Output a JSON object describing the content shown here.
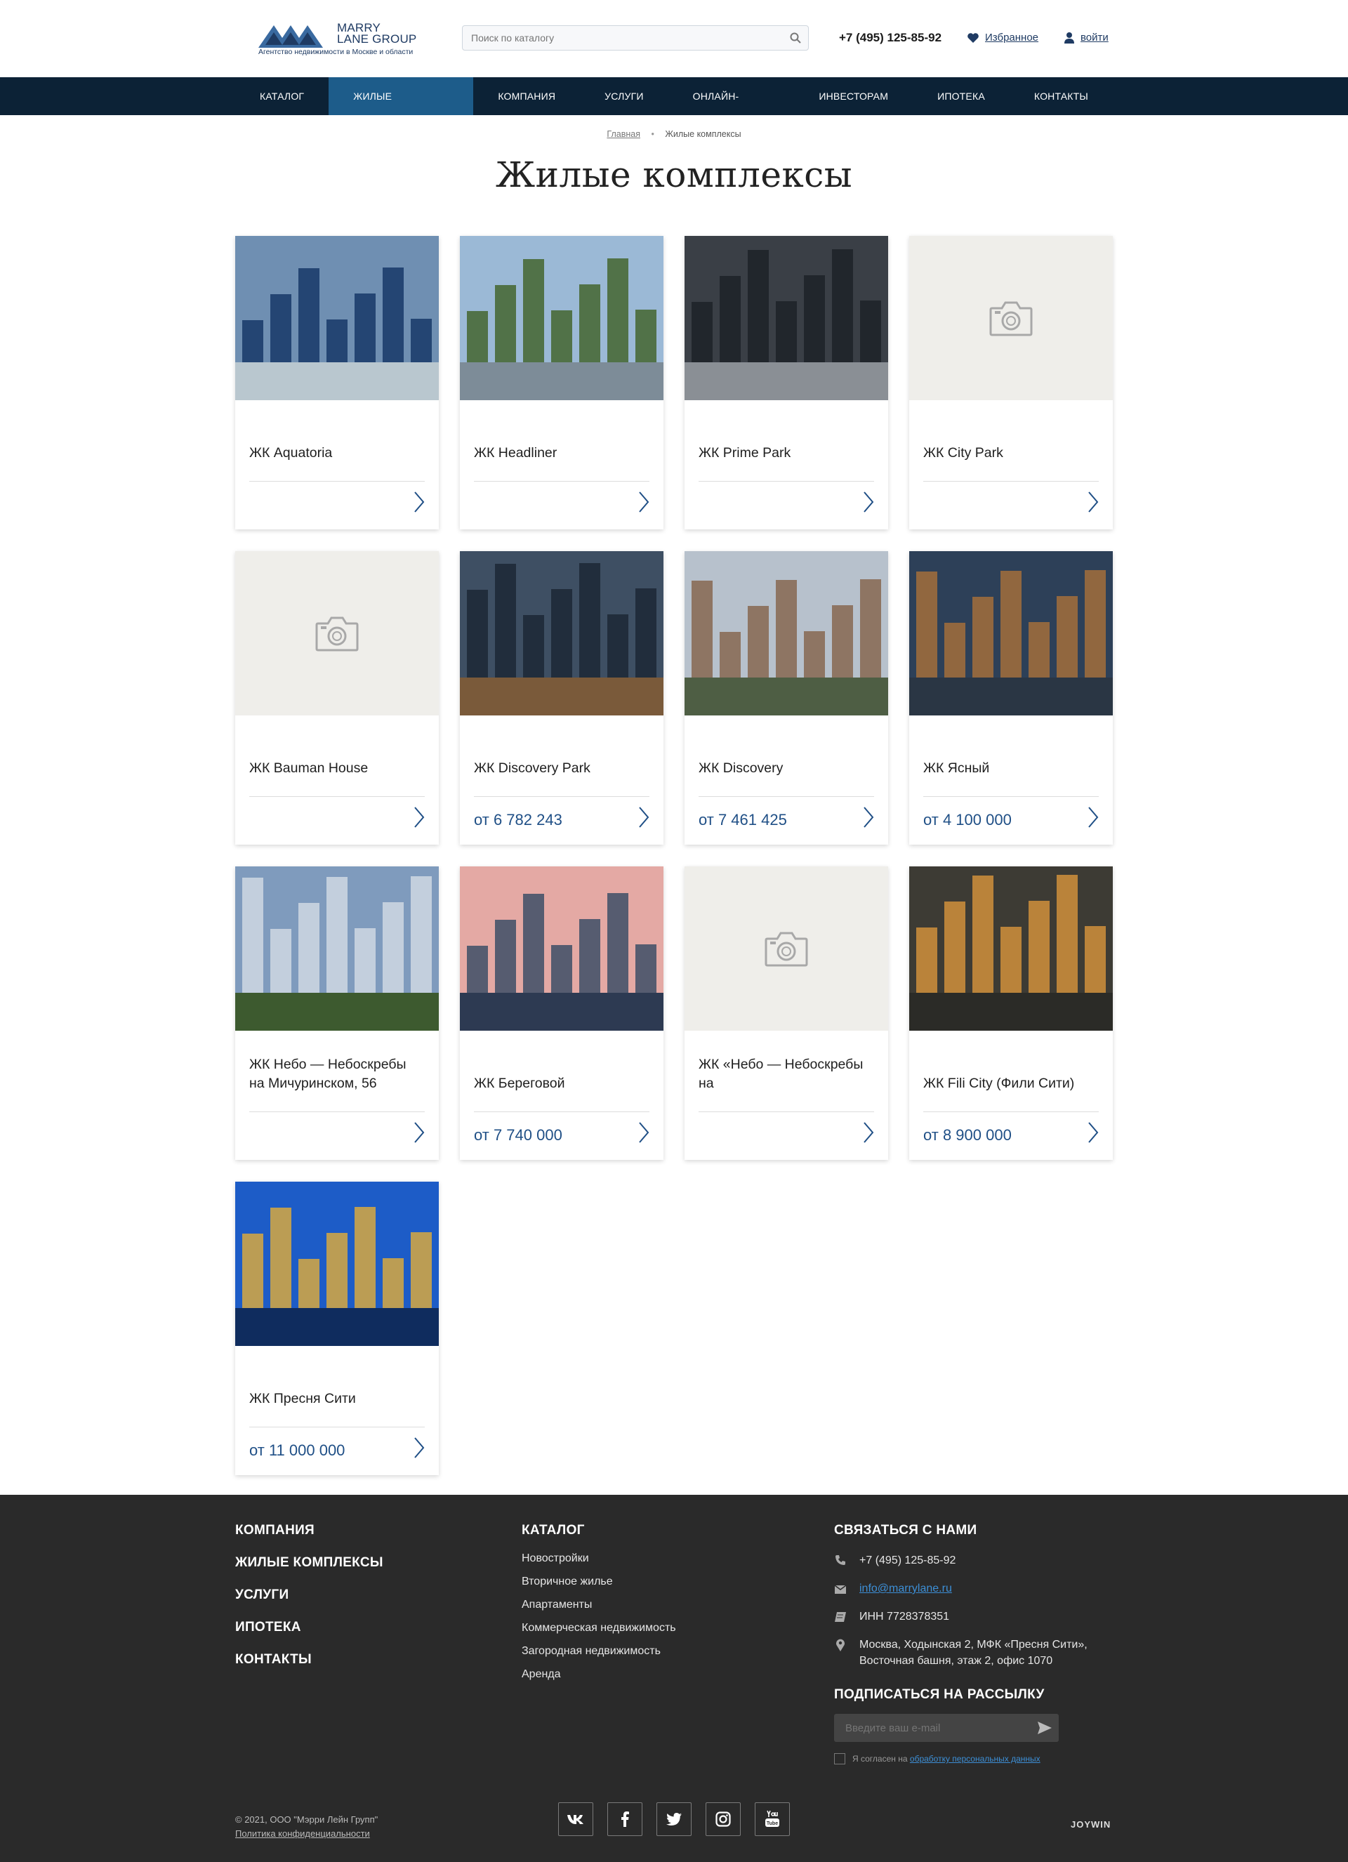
{
  "header": {
    "logo_name_line1": "MARRY",
    "logo_name_line2": "LANE GROUP",
    "logo_tagline": "Агентство недвижимости в Москве и области",
    "search_placeholder": "Поиск по каталогу",
    "phone": "+7 (495) 125-85-92",
    "favorites_label": "Избранное",
    "login_label": "войти"
  },
  "nav": {
    "items": [
      "Каталог",
      "Жилые комплексы",
      "Компания",
      "Услуги",
      "Онлайн-услуги",
      "Инвесторам",
      "Ипотека",
      "Контакты"
    ],
    "active": "Жилые комплексы"
  },
  "breadcrumb": {
    "home": "Главная",
    "current": "Жилые комплексы"
  },
  "page_title": "Жилые комплексы",
  "complexes": [
    {
      "name": "ЖК Aquatoria",
      "price": "",
      "image": "photo"
    },
    {
      "name": "ЖК Headliner",
      "price": "",
      "image": "photo"
    },
    {
      "name": "ЖК Prime Park",
      "price": "",
      "image": "photo"
    },
    {
      "name": "ЖК City Park",
      "price": "",
      "image": "placeholder"
    },
    {
      "name": "ЖК Bauman House",
      "price": "",
      "image": "placeholder"
    },
    {
      "name": "ЖК Discovery Park",
      "price": "от 6 782 243",
      "image": "photo"
    },
    {
      "name": "ЖК Discovery",
      "price": "от 7 461 425",
      "image": "photo"
    },
    {
      "name": "ЖК Ясный",
      "price": "от 4 100 000",
      "image": "photo"
    },
    {
      "name": "ЖК Небо — Небоскребы на Мичуринском, 56",
      "price": "",
      "image": "photo"
    },
    {
      "name": "ЖК Береговой",
      "price": "от 7 740 000",
      "image": "photo"
    },
    {
      "name": "ЖК «Небо — Небоскребы на",
      "price": "",
      "image": "placeholder"
    },
    {
      "name": "ЖК Fili City (Фили Сити)",
      "price": "от 8 900 000",
      "image": "photo"
    },
    {
      "name": "ЖК Пресня Сити",
      "price": "от 11 000 000",
      "image": "photo"
    }
  ],
  "footer": {
    "col1": [
      "Компания",
      "Жилые комплексы",
      "Услуги",
      "Ипотека",
      "Контакты"
    ],
    "catalog_title": "Каталог",
    "catalog_links": [
      "Новостройки",
      "Вторичное жилье",
      "Апартаменты",
      "Коммерческая недвижимость",
      "Загородная недвижимость",
      "Аренда"
    ],
    "contact_title": "Связаться с нами",
    "contact_phone": "+7 (495) 125-85-92",
    "contact_email": "info@marrylane.ru",
    "contact_inn": "ИНН 7728378351",
    "contact_address": "Москва, Ходынская 2, МФК «Пресня Сити», Восточная башня, этаж 2, офис 1070",
    "subscribe_title": "Подписаться на рассылку",
    "subscribe_placeholder": "Введите ваш e-mail",
    "agree_prefix": "Я согласен на",
    "agree_link": "обработку персональных данных",
    "copyright": "© 2021, ООО \"Мэрри Лейн Групп\"",
    "privacy_link": "Политика конфиденциальности",
    "socials": [
      "vk-icon",
      "facebook-icon",
      "twitter-icon",
      "instagram-icon",
      "youtube-icon"
    ],
    "developer": "JOYWIN"
  }
}
